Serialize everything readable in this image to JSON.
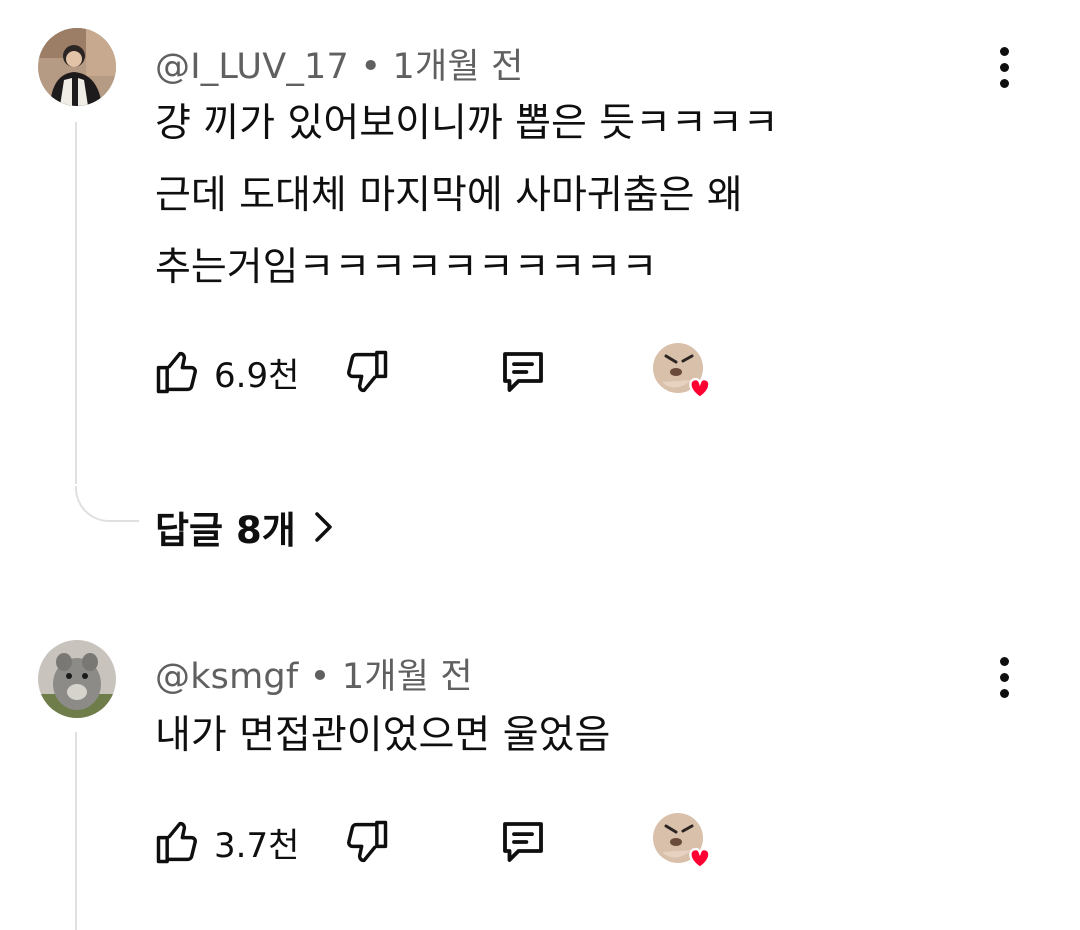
{
  "comments": [
    {
      "handle": "@I_LUV_17",
      "time": "1개월 전",
      "text": "걍 끼가 있어보이니까 뽑은 듯ㅋㅋㅋㅋ\n근데 도대체 마지막에 사마귀춤은 왜\n추는거임ㅋㅋㅋㅋㅋㅋㅋㅋㅋㅋ",
      "likes": "6.9천",
      "replies": "답글 8개"
    },
    {
      "handle": "@ksmgf",
      "time": "1개월 전",
      "text": "내가 면접관이었으면 울었음",
      "likes": "3.7천"
    }
  ],
  "icons": {
    "like": "thumbs-up-icon",
    "dislike": "thumbs-down-icon",
    "reply": "comment-icon",
    "more": "more-vertical-icon",
    "chevron": "chevron-right-icon"
  },
  "colors": {
    "text": "#0f0f0f",
    "meta": "#606060",
    "heart": "#ff0033",
    "thread_line": "#e0e0e0"
  }
}
